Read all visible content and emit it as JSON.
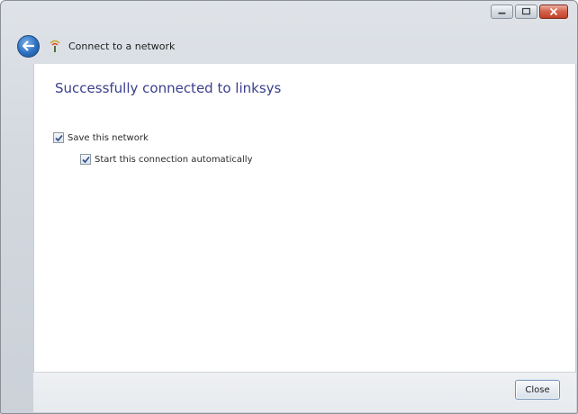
{
  "window": {
    "title": "Connect to a network"
  },
  "caption_buttons": {
    "minimize_icon": "minimize-icon",
    "maximize_icon": "maximize-icon",
    "close_icon": "close-icon"
  },
  "main": {
    "heading": "Successfully connected to linksys",
    "options": [
      {
        "label": "Save this network",
        "checked": true
      },
      {
        "label": "Start this connection automatically",
        "checked": true
      }
    ]
  },
  "footer": {
    "close_label": "Close"
  },
  "colors": {
    "heading": "#3a3f8c",
    "close_caption": "#c2412a",
    "back_button": "#2d6fc0"
  }
}
